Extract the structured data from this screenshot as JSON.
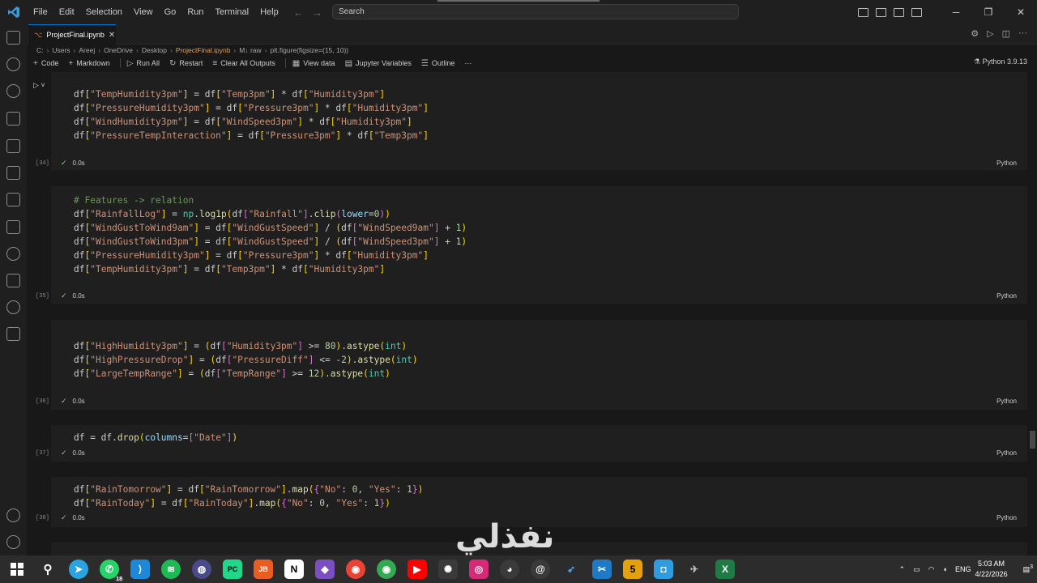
{
  "window": {
    "menu": [
      "File",
      "Edit",
      "Selection",
      "View",
      "Go",
      "Run",
      "Terminal",
      "Help"
    ],
    "search_label": "Search"
  },
  "tab": {
    "filename": "ProjectFinal.ipynb"
  },
  "breadcrumb": [
    "C:",
    "Users",
    "Areej",
    "OneDrive",
    "Desktop",
    "ProjectFinal.ipynb",
    "M↓ raw",
    "plt.figure(figsize=(15, 10))"
  ],
  "toolbar": {
    "code": "Code",
    "markdown": "Markdown",
    "run_all": "Run All",
    "restart": "Restart",
    "clear_outputs": "Clear All Outputs",
    "view_data": "View data",
    "jupyter_vars": "Jupyter Variables",
    "outline": "Outline",
    "more": "···",
    "kernel": "Python 3.9.13"
  },
  "cells": [
    {
      "exec": "[34]",
      "time": "0.0s",
      "lang": "Python"
    },
    {
      "exec": "[35]",
      "time": "0.0s",
      "lang": "Python"
    },
    {
      "exec": "[36]",
      "time": "0.0s",
      "lang": "Python"
    },
    {
      "exec": "[37]",
      "time": "0.0s",
      "lang": "Python"
    },
    {
      "exec": "[38]",
      "time": "0.0s",
      "lang": "Python"
    }
  ],
  "watermark": "نفذلي",
  "taskbar": {
    "lang": "ENG",
    "time": "5:03 AM",
    "date": "4/22/2026",
    "whatsapp_badge": "18",
    "notif_badge": "3"
  }
}
